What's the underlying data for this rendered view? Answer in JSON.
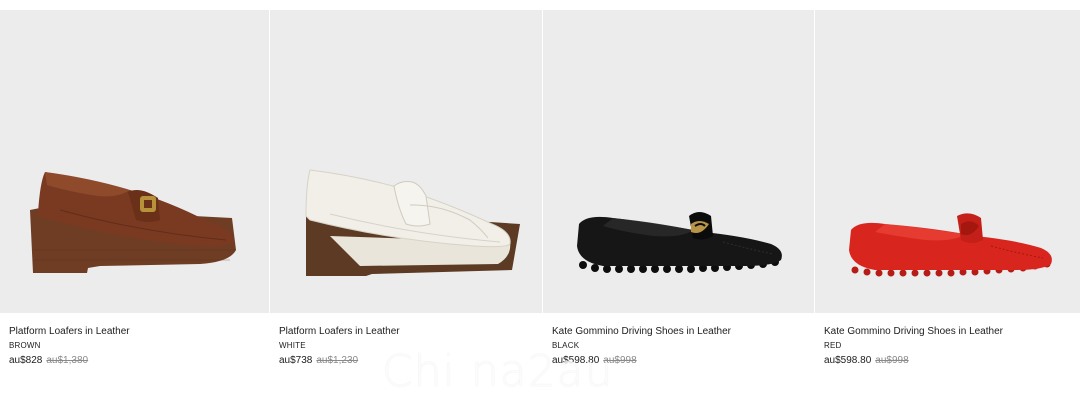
{
  "products": [
    {
      "name": "Platform Loafers in Leather",
      "color": "BROWN",
      "price": "au$828",
      "original_price": "au$1,380",
      "shoe_color": "#7a3a22",
      "heel_color": "#6e3d24",
      "style": "platform"
    },
    {
      "name": "Platform Loafers in Leather",
      "color": "WHITE",
      "price": "au$738",
      "original_price": "au$1,230",
      "shoe_color": "#f1efe8",
      "heel_color": "#5c3a24",
      "style": "platform"
    },
    {
      "name": "Kate Gommino Driving Shoes in Leather",
      "color": "BLACK",
      "price": "au$598.80",
      "original_price": "au$998",
      "shoe_color": "#161616",
      "heel_color": "#0d0d0d",
      "style": "driving"
    },
    {
      "name": "Kate Gommino Driving Shoes in Leather",
      "color": "RED",
      "price": "au$598.80",
      "original_price": "au$998",
      "shoe_color": "#d8261e",
      "heel_color": "#b61c16",
      "style": "driving"
    }
  ],
  "watermark": "Chi na2au"
}
